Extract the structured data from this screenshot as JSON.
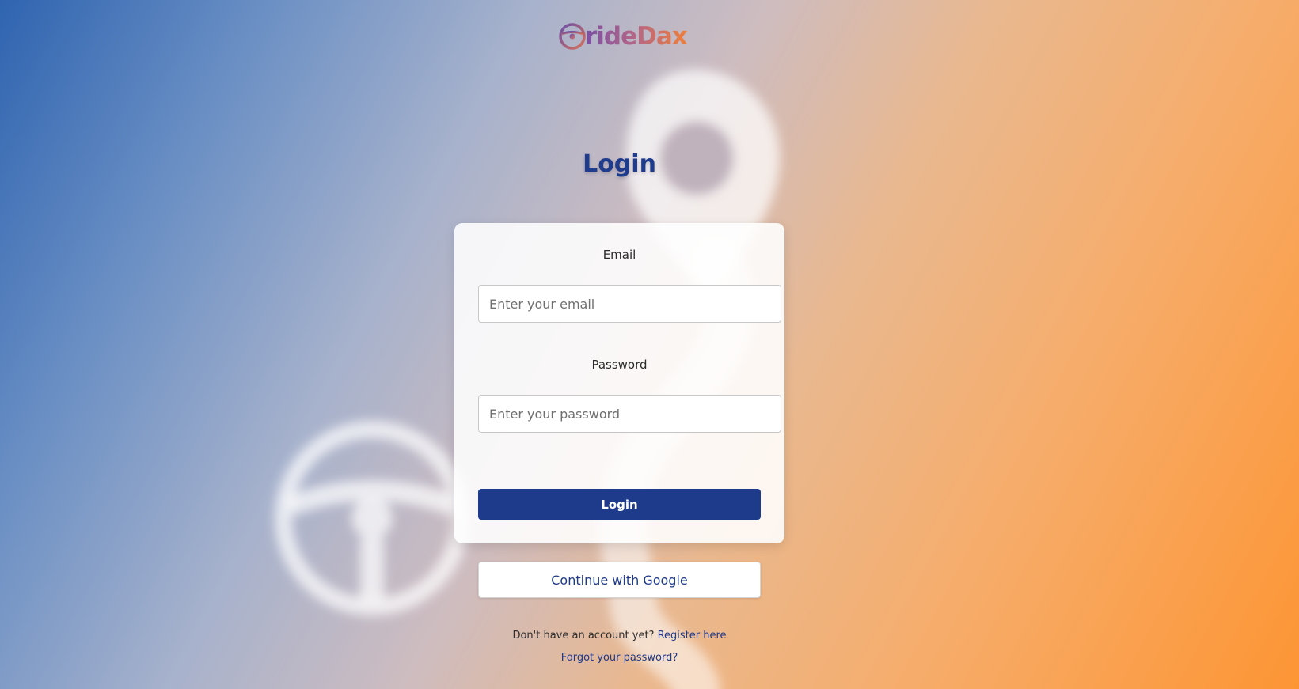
{
  "brand": {
    "logo_text": "rideDax",
    "logo_icon": "steering-wheel-icon"
  },
  "page": {
    "title": "Login"
  },
  "form": {
    "email_label": "Email",
    "email_placeholder": "Enter your email",
    "password_label": "Password",
    "password_placeholder": "Enter your password",
    "login_label": "Login"
  },
  "alt_login": {
    "google_label": "Continue with Google"
  },
  "footer": {
    "register_prompt": "Don't have an account yet?",
    "register_link": "Register here",
    "forgot_link": "Forgot your password?"
  },
  "colors": {
    "primary": "#1e3a8a",
    "gradient_start": "#2f64b0",
    "gradient_end": "#fd9534"
  }
}
